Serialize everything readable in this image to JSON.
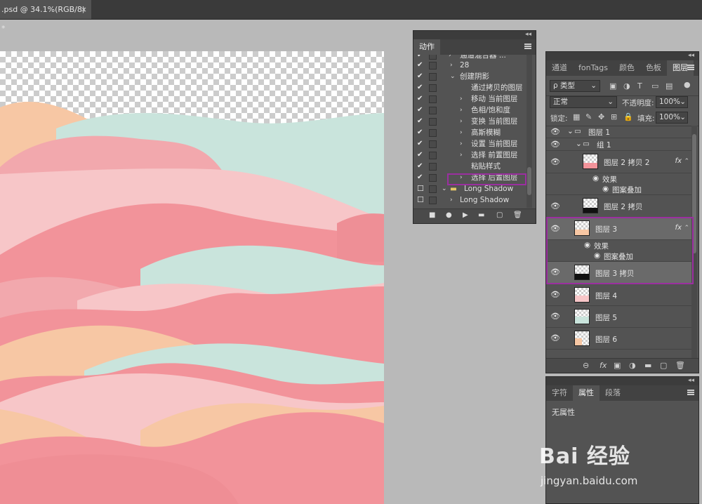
{
  "document_tab": {
    "title": ".psd @ 34.1%(RGB/8) *",
    "close": "×"
  },
  "actions_panel": {
    "tab": "动作",
    "rows": [
      {
        "text": "通道混合器 ...",
        "level": 0,
        "check": true
      },
      {
        "text": "28",
        "level": 1,
        "check": true
      },
      {
        "text": "创建阴影",
        "level": 1,
        "check": true,
        "open": true
      },
      {
        "text": "通过拷贝的图层",
        "level": 2,
        "check": true
      },
      {
        "text": "移动 当前图层",
        "level": 2,
        "check": true
      },
      {
        "text": "色相/饱和度",
        "level": 2,
        "check": true
      },
      {
        "text": "变换 当前图层",
        "level": 2,
        "check": true
      },
      {
        "text": "高斯模糊",
        "level": 2,
        "check": true
      },
      {
        "text": "设置 当前图层",
        "level": 2,
        "check": true
      },
      {
        "text": "选择 前置图层",
        "level": 2,
        "check": true
      },
      {
        "text": "粘贴样式",
        "level": 2,
        "check": true
      },
      {
        "text": "选择 后置图层",
        "level": 2,
        "check": true
      },
      {
        "text": "Long Shadow",
        "level": 0,
        "check": false,
        "folder": true
      },
      {
        "text": "Long Shadow",
        "level": 1,
        "check": false
      }
    ]
  },
  "layers_panel": {
    "tabs": [
      "通道",
      "fonTags",
      "颜色",
      "色板",
      "图层"
    ],
    "active_tab": "图层",
    "filter_label": "ρ 类型",
    "blend_mode": "正常",
    "opacity_label": "不透明度:",
    "opacity_value": "100%",
    "lock_label": "锁定:",
    "fill_label": "填充:",
    "fill_value": "100%",
    "layers": [
      {
        "name": "图层 1",
        "type": "group"
      },
      {
        "name": "组 1",
        "type": "group"
      },
      {
        "name": "图层 2 拷贝 2",
        "type": "layer",
        "fx": "fx"
      },
      {
        "name": "效果",
        "type": "effect"
      },
      {
        "name": "图案叠加",
        "type": "effect-item"
      },
      {
        "name": "图层 2 拷贝",
        "type": "layer"
      },
      {
        "name": "图层 3",
        "type": "layer",
        "fx": "fx"
      },
      {
        "name": "效果",
        "type": "effect"
      },
      {
        "name": "图案叠加",
        "type": "effect-item"
      },
      {
        "name": "图层 3 拷贝",
        "type": "layer"
      },
      {
        "name": "图层 4",
        "type": "layer"
      },
      {
        "name": "图层 5",
        "type": "layer"
      },
      {
        "name": "图层 6",
        "type": "layer"
      }
    ]
  },
  "properties_panel": {
    "tabs": [
      "字符",
      "属性",
      "段落"
    ],
    "active_tab": "属性",
    "content": "无属性"
  },
  "watermark": {
    "brand": "Bai 经验",
    "url": "jingyan.baidu.com"
  },
  "colors": {
    "pink": "#f2939a",
    "light_pink": "#f7c6c8",
    "mint": "#c9e4dc",
    "peach": "#f7c7a4",
    "highlight": "#9b2fa0"
  }
}
